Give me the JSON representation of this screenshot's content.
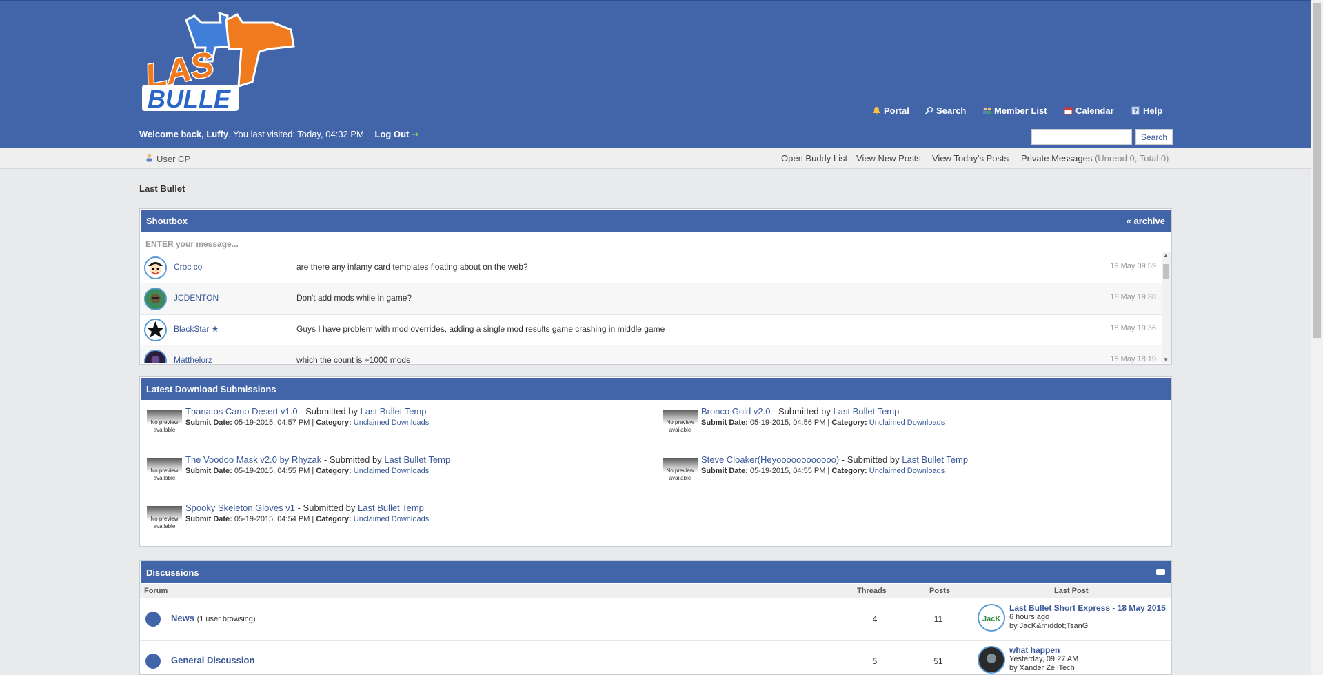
{
  "header": {
    "logo_text_top": "LAS",
    "logo_text_bottom": "BULLE",
    "nav": [
      {
        "label": "Portal",
        "icon": "bell-icon"
      },
      {
        "label": "Search",
        "icon": "magnifier-icon"
      },
      {
        "label": "Member List",
        "icon": "members-icon"
      },
      {
        "label": "Calendar",
        "icon": "calendar-icon"
      },
      {
        "label": "Help",
        "icon": "help-icon"
      }
    ],
    "welcome_prefix": "Welcome back, ",
    "username": "Luffy",
    "welcome_suffix": ". You last visited: Today, 04:32 PM",
    "logout_label": "Log Out",
    "search_button": "Search"
  },
  "userbar": {
    "usercp": "User CP",
    "links": [
      "Open Buddy List",
      "View New Posts",
      "View Today's Posts",
      "Private Messages"
    ],
    "pm_status": "(Unread 0, Total 0)"
  },
  "breadcrumb": "Last Bullet",
  "shoutbox": {
    "title": "Shoutbox",
    "archive": "« archive",
    "placeholder": "ENTER your message...",
    "rows": [
      {
        "user": "Croc co",
        "message": "are there any infamy card templates floating about on the web?",
        "time": "19 May 09:59"
      },
      {
        "user": "JCDENTON",
        "message": "Don't add mods while in game?",
        "time": "18 May 19:38"
      },
      {
        "user": "BlackStar ★",
        "message": "Guys I have problem with mod overrides, adding a single mod results game crashing in middle game",
        "time": "18 May 19:36"
      },
      {
        "user": "Matthelorz",
        "message": "which the count is +1000 mods",
        "time": "18 May 18:19"
      }
    ]
  },
  "downloads": {
    "title": "Latest Download Submissions",
    "no_preview": "No preview available",
    "submitted_by_label": " - Submitted by ",
    "date_label": "Submit Date:",
    "category_label": "Category:",
    "items": [
      {
        "title": "Thanatos Camo Desert v1.0",
        "submitter": "Last Bullet Temp",
        "date": "05-19-2015, 04:57 PM",
        "category": "Unclaimed Downloads"
      },
      {
        "title": "Bronco Gold v2.0",
        "submitter": "Last Bullet Temp",
        "date": "05-19-2015, 04:56 PM",
        "category": "Unclaimed Downloads"
      },
      {
        "title": "The Voodoo Mask v2.0 by Rhyzak",
        "submitter": "Last Bullet Temp",
        "date": "05-19-2015, 04:55 PM",
        "category": "Unclaimed Downloads"
      },
      {
        "title": "Steve Cloaker(Heyoooooooooooo)",
        "submitter": "Last Bullet Temp",
        "date": "05-19-2015, 04:55 PM",
        "category": "Unclaimed Downloads"
      },
      {
        "title": "Spooky Skeleton Gloves v1",
        "submitter": "Last Bullet Temp",
        "date": "05-19-2015, 04:54 PM",
        "category": "Unclaimed Downloads"
      }
    ]
  },
  "discussions": {
    "title": "Discussions",
    "columns": {
      "forum": "Forum",
      "threads": "Threads",
      "posts": "Posts",
      "last_post": "Last Post"
    },
    "forums": [
      {
        "name": "News",
        "note": "(1 user browsing)",
        "threads": "4",
        "posts": "11",
        "lp_title": "Last Bullet Short Express - 18 May 2015",
        "lp_time": "6 hours ago",
        "lp_by": "by JacK&middot;TsanG",
        "lp_avatar": "JacK"
      },
      {
        "name": "General Discussion",
        "note": "",
        "threads": "5",
        "posts": "51",
        "lp_title": "what happen",
        "lp_time": "Yesterday, 09:27 AM",
        "lp_by": "by Xander Ze iTech",
        "lp_avatar": ""
      }
    ]
  },
  "colors": {
    "header_blue": "#4264a9",
    "link_blue": "#3b5998",
    "page_bg": "#e9eaeb"
  }
}
